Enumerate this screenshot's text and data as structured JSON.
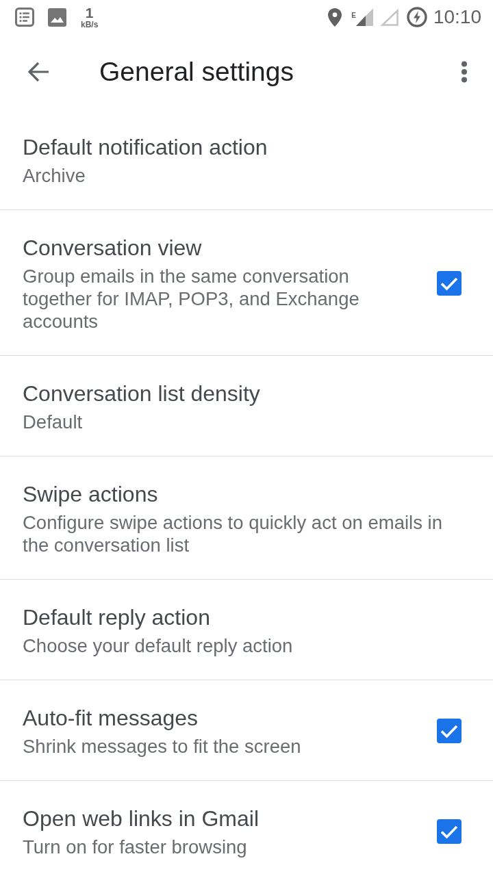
{
  "status_bar": {
    "net_speed": {
      "value": "1",
      "unit": "kB/s"
    },
    "network_type": "E",
    "time": "10:10"
  },
  "toolbar": {
    "title": "General settings"
  },
  "settings": [
    {
      "kind": "text",
      "title": "Default notification action",
      "subtitle": "Archive"
    },
    {
      "kind": "checkbox",
      "title": "Conversation view",
      "subtitle": "Group emails in the same conversation together for IMAP, POP3, and Exchange accounts",
      "checked": true
    },
    {
      "kind": "text",
      "title": "Conversation list density",
      "subtitle": "Default"
    },
    {
      "kind": "text",
      "title": "Swipe actions",
      "subtitle": "Configure swipe actions to quickly act on emails in the conversation list"
    },
    {
      "kind": "text",
      "title": "Default reply action",
      "subtitle": "Choose your default reply action"
    },
    {
      "kind": "checkbox",
      "title": "Auto-fit messages",
      "subtitle": "Shrink messages to fit the screen",
      "checked": true
    },
    {
      "kind": "checkbox",
      "title": "Open web links in Gmail",
      "subtitle": "Turn on for faster browsing",
      "checked": true
    }
  ]
}
